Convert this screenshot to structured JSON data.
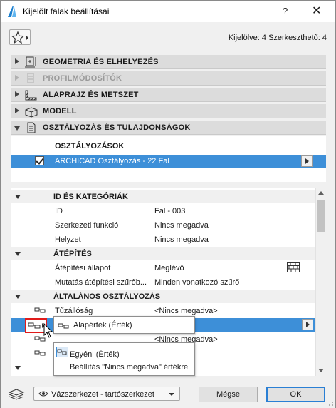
{
  "window": {
    "title": "Kijelölt falak beállításai",
    "help": "?",
    "close": "✕"
  },
  "header": {
    "selection_info": "Kijelölve: 4 Szerkeszthető: 4"
  },
  "panels": [
    {
      "label": "GEOMETRIA ÉS ELHELYEZÉS",
      "state": "collapsed"
    },
    {
      "label": "PROFILMÓDOSÍTÓK",
      "state": "disabled"
    },
    {
      "label": "ALAPRAJZ ÉS METSZET",
      "state": "collapsed"
    },
    {
      "label": "MODELL",
      "state": "collapsed"
    },
    {
      "label": "OSZTÁLYOZÁS ÉS TULAJDONSÁGOK",
      "state": "expanded"
    }
  ],
  "classifications": {
    "header": "OSZTÁLYOZÁSOK",
    "row": "ARCHICAD Osztályozás - 22 Fal"
  },
  "properties": {
    "group1": "ID ÉS KATEGÓRIÁK",
    "id_name": "ID",
    "id_value": "Fal - 003",
    "func_name": "Szerkezeti funkció",
    "func_value": "Nincs megadva",
    "pos_name": "Helyzet",
    "pos_value": "Nincs megadva",
    "group2": "ÁTÉPÍTÉS",
    "status_name": "Átépítési állapot",
    "status_value": "Meglévő",
    "filter_name": "Mutatás átépítési szűrőb...",
    "filter_value": "Minden vonatkozó szűrő",
    "group3": "ÁLTALÁNOS OSZTÁLYOZÁS",
    "fire_name": "Tűzállóság",
    "fire_value": "<Nincs megadva>",
    "row2_value": "<Nincs megadva>"
  },
  "popup": {
    "item1": "Alapérték (Érték)",
    "item2": "Egyéni (Érték)",
    "item3": "Beállítás \"Nincs megadva\" értékre"
  },
  "footer": {
    "layer_combo": "Vázszerkezet - tartószerkezet",
    "cancel": "Mégse",
    "ok": "OK"
  }
}
